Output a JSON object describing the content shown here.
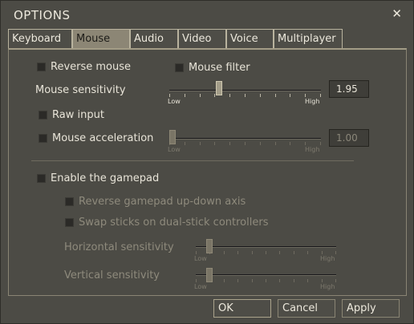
{
  "window": {
    "title": "OPTIONS",
    "close_glyph": "✕"
  },
  "tabs": [
    {
      "label": "Keyboard",
      "active": false
    },
    {
      "label": "Mouse",
      "active": true
    },
    {
      "label": "Audio",
      "active": false
    },
    {
      "label": "Video",
      "active": false
    },
    {
      "label": "Voice",
      "active": false
    },
    {
      "label": "Multiplayer",
      "active": false
    }
  ],
  "mouse": {
    "reverse_mouse": {
      "label": "Reverse mouse",
      "checked": false
    },
    "mouse_filter": {
      "label": "Mouse filter",
      "checked": false
    },
    "sensitivity": {
      "label": "Mouse sensitivity",
      "value": "1.95",
      "low": "Low",
      "high": "High",
      "level": 0.32
    },
    "raw_input": {
      "label": "Raw input",
      "checked": false
    },
    "acceleration": {
      "label": "Mouse acceleration",
      "checked": false,
      "value": "1.00",
      "low": "Low",
      "high": "High",
      "level": 0.0
    }
  },
  "gamepad": {
    "enable": {
      "label": "Enable the gamepad",
      "checked": false
    },
    "reverse_axis": {
      "label": "Reverse gamepad up-down axis",
      "checked": false
    },
    "swap_sticks": {
      "label": "Swap sticks on dual-stick controllers",
      "checked": false
    },
    "horizontal": {
      "label": "Horizontal sensitivity",
      "low": "Low",
      "high": "High",
      "level": 0.08
    },
    "vertical": {
      "label": "Vertical sensitivity",
      "low": "Low",
      "high": "High",
      "level": 0.08
    }
  },
  "buttons": {
    "ok": "OK",
    "cancel": "Cancel",
    "apply": "Apply"
  },
  "colors": {
    "dialog_bg": "#4c4b45",
    "active_tab": "#8c8675",
    "text": "#e8e4d8",
    "disabled_text": "#8e8a7c"
  }
}
